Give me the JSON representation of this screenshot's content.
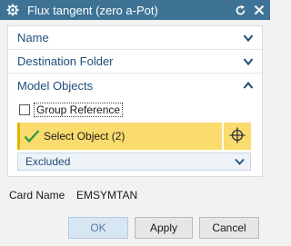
{
  "window": {
    "title": "Flux tangent (zero a-Pot)",
    "titlebar_color": "#3e7396",
    "icons": [
      "gear-icon",
      "reset-icon",
      "close-icon"
    ]
  },
  "sections": {
    "name": {
      "label": "Name",
      "state": "collapsed"
    },
    "destination": {
      "label": "Destination Folder",
      "state": "collapsed"
    },
    "model_objects": {
      "label": "Model Objects",
      "state": "expanded",
      "group_reference": {
        "label": "Group Reference",
        "checked": false
      },
      "select_object": {
        "label": "Select Object (2)",
        "highlight": "#fadc6e",
        "icon": "crosshair-icon"
      },
      "filter_dropdown": {
        "value": "Excluded"
      }
    }
  },
  "card": {
    "label": "Card Name",
    "value": "EMSYMTAN"
  },
  "buttons": {
    "ok": "OK",
    "apply": "Apply",
    "cancel": "Cancel"
  }
}
